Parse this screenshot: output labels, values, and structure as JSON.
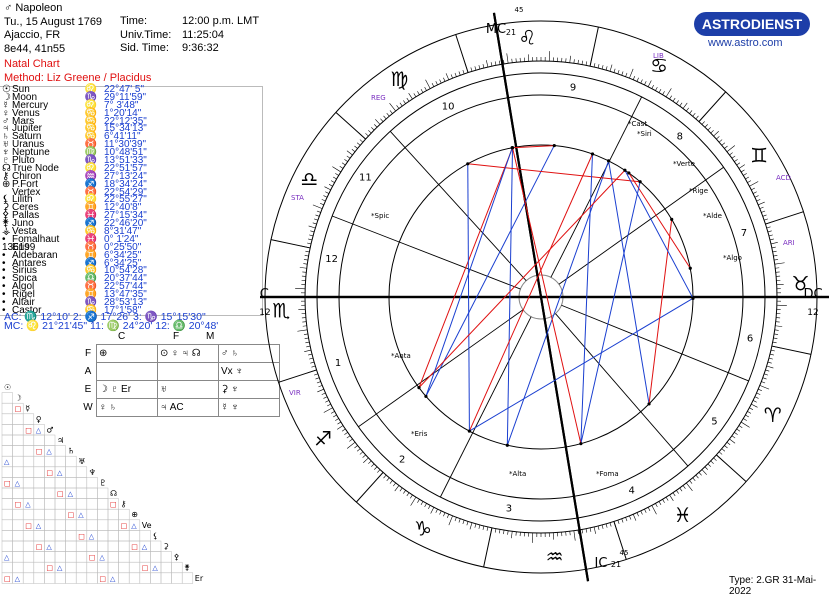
{
  "header": {
    "name": "Napoleon",
    "date": "Tu., 15 August 1769",
    "place": "Ajaccio, FR",
    "coords": "8e44, 41n55",
    "time_label": "Time:",
    "time_value": "12:00 p.m. LMT",
    "ut_label": "Univ.Time:",
    "ut_value": "11:25:04",
    "sid_label": "Sid. Time:",
    "sid_value": "9:36:32",
    "chart_type": "Natal Chart",
    "method": "Method: Liz Greene / Placidus"
  },
  "logo": {
    "text": "ASTRODIENST",
    "url": "www.astro.com"
  },
  "planets": [
    {
      "glyph": "☉",
      "name": "Sun",
      "sign": "♌",
      "pos": "22°47' 5\""
    },
    {
      "glyph": "☽",
      "name": "Moon",
      "sign": "♑",
      "pos": "29°11'59\""
    },
    {
      "glyph": "☿",
      "name": "Mercury",
      "sign": "♌",
      "pos": "7° 3'48\""
    },
    {
      "glyph": "♀",
      "name": "Venus",
      "sign": "♋",
      "pos": "1°20'14\""
    },
    {
      "glyph": "♂",
      "name": "Mars",
      "sign": "♋",
      "pos": "22°12'35\""
    },
    {
      "glyph": "♃",
      "name": "Jupiter",
      "sign": "♋",
      "pos": "15°34'13\""
    },
    {
      "glyph": "♄",
      "name": "Saturn",
      "sign": "♋",
      "pos": "6°41'11\""
    },
    {
      "glyph": "♅",
      "name": "Uranus",
      "sign": "♉",
      "pos": "11°30'39\""
    },
    {
      "glyph": "♆",
      "name": "Neptune",
      "sign": "♍",
      "pos": "10°48'51\""
    },
    {
      "glyph": "♇",
      "name": "Pluto",
      "sign": "♑",
      "pos": "13°51'33\""
    },
    {
      "glyph": "☊",
      "name": "True Node",
      "sign": "♌",
      "pos": "22°51'57\""
    },
    {
      "glyph": "⚷",
      "name": "Chiron",
      "sign": "♒",
      "pos": "27°13'24\""
    },
    {
      "glyph": "⊕",
      "name": "P.Fort",
      "sign": "♐",
      "pos": "18°34'24\""
    },
    {
      "glyph": "",
      "name": "Vertex",
      "sign": "♉",
      "pos": "22°54'29\""
    },
    {
      "glyph": "⚸",
      "name": "Lilith",
      "sign": "♌",
      "pos": "22°55'27\""
    },
    {
      "glyph": "⚳",
      "name": "Ceres",
      "sign": "♊",
      "pos": "12°40'8\""
    },
    {
      "glyph": "⚴",
      "name": "Pallas",
      "sign": "♓",
      "pos": "27°15'34\""
    },
    {
      "glyph": "⚵",
      "name": "Juno",
      "sign": "♐",
      "pos": "22°46'20\""
    },
    {
      "glyph": "⚶",
      "name": "Vesta",
      "sign": "♋",
      "pos": "8°31'47\""
    },
    {
      "glyph": "•",
      "name": "Fomalhaut",
      "sign": "♓",
      "pos": "0° 1'24\""
    },
    {
      "glyph": "136199",
      "name": "Eris",
      "sign": "♉",
      "pos": "0°25'50\""
    },
    {
      "glyph": "•",
      "name": "Aldebaran",
      "sign": "♊",
      "pos": "6°34'25\""
    },
    {
      "glyph": "•",
      "name": "Antares",
      "sign": "♐",
      "pos": "6°34'25\""
    },
    {
      "glyph": "•",
      "name": "Sirius",
      "sign": "♋",
      "pos": "10°54'28\""
    },
    {
      "glyph": "•",
      "name": "Spica",
      "sign": "♎",
      "pos": "20°37'44\""
    },
    {
      "glyph": "•",
      "name": "Algol",
      "sign": "♉",
      "pos": "22°57'44\""
    },
    {
      "glyph": "•",
      "name": "Rigel",
      "sign": "♊",
      "pos": "13°47'35\""
    },
    {
      "glyph": "•",
      "name": "Altair",
      "sign": "♑",
      "pos": "28°53'13\""
    },
    {
      "glyph": "•",
      "name": "Castor",
      "sign": "♋",
      "pos": "17°1'58\""
    }
  ],
  "houses": {
    "line1": "AC: ♏ 12°10'    2: ♐ 17°26'    3: ♑ 15°15'30\"",
    "line2": "MC: ♌ 21°21'45\"  11: ♍ 24°20'  12: ♎ 20°48'"
  },
  "elements": {
    "columns": [
      "C",
      "F",
      "M"
    ],
    "rows": [
      {
        "label": "F",
        "cells": [
          "⊕",
          "⊙ ♀ ♃ ☊",
          "♂ ♄"
        ]
      },
      {
        "label": "A",
        "cells": [
          "",
          "",
          "Vx ♆"
        ]
      },
      {
        "label": "E",
        "cells": [
          "☽ ♇ Er",
          "♅",
          "⚳ ♆"
        ]
      },
      {
        "label": "W",
        "cells": [
          "♀ ♄",
          "♃ AC",
          "☿ ♆"
        ]
      }
    ]
  },
  "grid": {
    "diagonal_labels": [
      "☉",
      "☽",
      "☿",
      "♀",
      "♂",
      "♃",
      "♄",
      "♅",
      "♆",
      "♇",
      "☊",
      "⚷",
      "⊕",
      "Ve",
      "⚸",
      "⚳",
      "⚴",
      "⚵",
      "Er",
      "A",
      "A",
      "S",
      "S",
      "A",
      "R",
      "A",
      "C"
    ]
  },
  "wheel": {
    "angles": {
      "AC": "AC",
      "AC_deg": "12",
      "DC": "DC",
      "DC_deg": "12",
      "MC": "MC",
      "MC_deg": "21",
      "MC_min": "45",
      "IC": "IC",
      "IC_deg": "21",
      "IC_min": "45"
    },
    "sign_glyphs": [
      "♈",
      "♉",
      "♊",
      "♋",
      "♌",
      "♍",
      "♎",
      "♏",
      "♐",
      "♑",
      "♒",
      "♓"
    ],
    "house_numbers": [
      "1",
      "2",
      "3",
      "4",
      "5",
      "6",
      "7",
      "8",
      "9",
      "10",
      "11",
      "12"
    ],
    "star_labels": [
      "Cast",
      "Siri",
      "Verte",
      "Rige",
      "Alde",
      "Algo",
      "Spic",
      "Anta",
      "Alta",
      "Foma",
      "Eris"
    ],
    "house_cusp_labels": [
      "REG",
      "LIB",
      "STA",
      "ACD",
      "ARI",
      "VIR"
    ]
  },
  "footer": {
    "type": "Type: 2.GR 31-Mai-2022"
  }
}
